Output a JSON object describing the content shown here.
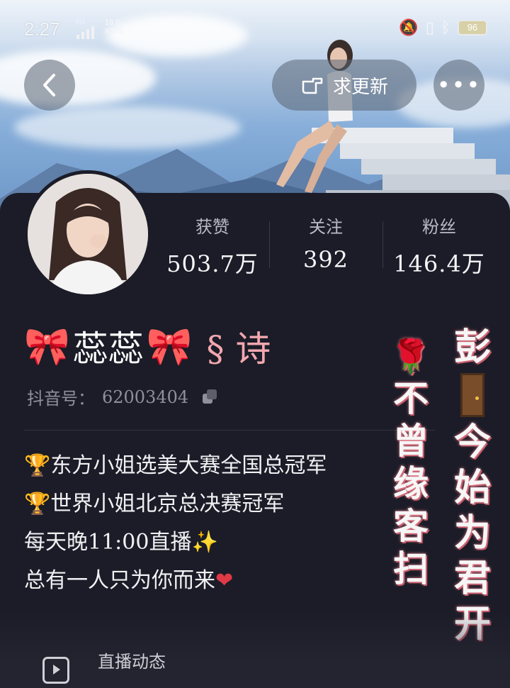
{
  "status_bar": {
    "time": "2:27",
    "network": "4G",
    "speed_value": "18.0",
    "speed_unit": "KB/S",
    "battery": "96"
  },
  "header": {
    "update_label": "求更新"
  },
  "stats": [
    {
      "label": "获赞",
      "value": "503.7万"
    },
    {
      "label": "关注",
      "value": "392"
    },
    {
      "label": "粉丝",
      "value": "146.4万"
    }
  ],
  "profile": {
    "nickname_bow": "🎀",
    "nickname_main": "蕊蕊",
    "nickname_tail": "§ 诗",
    "douyin_id_label": "抖音号：",
    "douyin_id": "62003404"
  },
  "bio": [
    {
      "icon": "🏆",
      "text": "东方小姐选美大赛全国总冠军"
    },
    {
      "icon": "🏆",
      "text": "世界小姐北京总决赛冠军"
    },
    {
      "icon": "",
      "text": "每天晚11:00直播",
      "suffix": "✨"
    },
    {
      "icon": "",
      "text": "总有一人只为你而来",
      "suffix": "❤"
    }
  ],
  "side_text": {
    "col_a_icon": "🌹",
    "col_a_chars": [
      "不",
      "曾",
      "缘",
      "客",
      "扫"
    ],
    "col_b_head": "彭",
    "col_b_chars": [
      "今",
      "始",
      "为",
      "君",
      "开"
    ]
  },
  "tabs": {
    "live_label": "直播动态"
  },
  "colors": {
    "panel_bg": "#1b1c27",
    "accent_red": "#e0303f",
    "trophy_gold": "#f3b33a"
  }
}
